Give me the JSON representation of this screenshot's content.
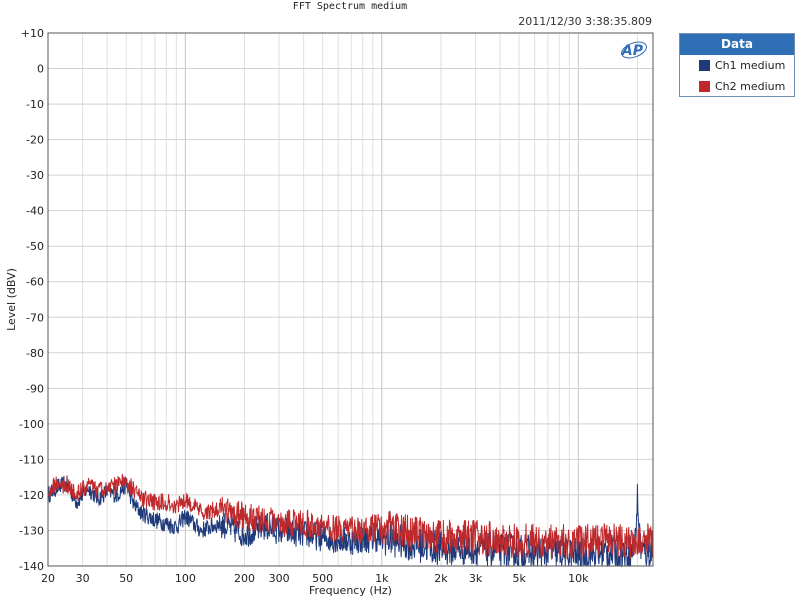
{
  "colors": {
    "ch1": "#1f3a7a",
    "ch2": "#c0292b",
    "legend_header": "#2f6fb6"
  },
  "chart_data": {
    "type": "line",
    "title": "FFT Spectrum medium",
    "timestamp": "2011/12/30 3:38:35.809",
    "xlabel": "Frequency (Hz)",
    "ylabel": "Level (dBV)",
    "xscale": "log",
    "xlim": [
      20,
      24000
    ],
    "ylim": [
      -140,
      10
    ],
    "grid": true,
    "legend_position": "right",
    "legend_title": "Data",
    "logo_text": "AP",
    "y_ticks": [
      "+10",
      "0",
      "-10",
      "-20",
      "-30",
      "-40",
      "-50",
      "-60",
      "-70",
      "-80",
      "-90",
      "-100",
      "-110",
      "-120",
      "-130",
      "-140"
    ],
    "y_tick_values": [
      10,
      0,
      -10,
      -20,
      -30,
      -40,
      -50,
      -60,
      -70,
      -80,
      -90,
      -100,
      -110,
      -120,
      -130,
      -140
    ],
    "x_ticks": [
      "20",
      "30",
      "50",
      "100",
      "200",
      "300",
      "500",
      "1k",
      "2k",
      "3k",
      "5k",
      "10k"
    ],
    "x_tick_values": [
      20,
      30,
      50,
      100,
      200,
      300,
      500,
      1000,
      2000,
      3000,
      5000,
      10000
    ],
    "series": [
      {
        "name": "Ch1 medium",
        "x": [
          20,
          22,
          25,
          28,
          32,
          36,
          40,
          45,
          50,
          55,
          60,
          70,
          80,
          90,
          100,
          120,
          150,
          200,
          250,
          300,
          400,
          500,
          700,
          1000,
          1500,
          2000,
          3000,
          5000,
          7000,
          10000,
          15000,
          18000,
          19000,
          19500,
          20000,
          20500,
          21000,
          22000,
          24000
        ],
        "y": [
          -120,
          -118,
          -117,
          -122,
          -118,
          -121,
          -119,
          -120,
          -117,
          -123,
          -125,
          -127,
          -128,
          -129,
          -126,
          -130,
          -128,
          -131,
          -129,
          -130,
          -131,
          -132,
          -133,
          -132,
          -134,
          -135,
          -135,
          -136,
          -136,
          -137,
          -136,
          -136,
          -136,
          -133,
          -121,
          -131,
          -136,
          -136,
          -136
        ]
      },
      {
        "name": "Ch2 medium",
        "x": [
          20,
          22,
          25,
          28,
          32,
          36,
          40,
          45,
          50,
          55,
          60,
          70,
          80,
          90,
          100,
          120,
          150,
          200,
          250,
          300,
          400,
          500,
          700,
          1000,
          1500,
          2000,
          3000,
          5000,
          7000,
          10000,
          15000,
          20000,
          24000
        ],
        "y": [
          -119,
          -117,
          -117,
          -120,
          -117,
          -119,
          -118,
          -117,
          -116,
          -119,
          -121,
          -122,
          -122,
          -123,
          -121,
          -125,
          -124,
          -126,
          -127,
          -128,
          -128,
          -129,
          -130,
          -129,
          -131,
          -132,
          -132,
          -133,
          -133,
          -133,
          -133,
          -133,
          -133
        ]
      }
    ]
  }
}
